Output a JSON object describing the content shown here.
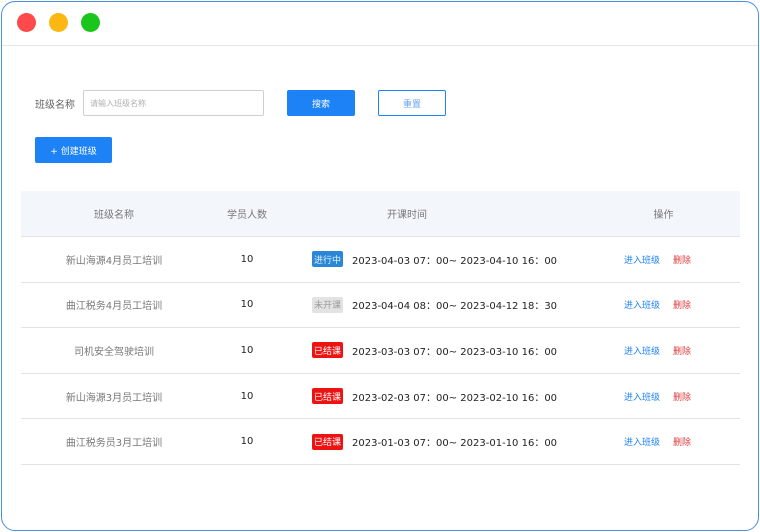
{
  "window": {
    "controls": [
      "close",
      "minimize",
      "maximize"
    ],
    "colors": {
      "close": "#fe4a4a",
      "minimize": "#fcb713",
      "maximize": "#1cc51c",
      "border": "#4a90e2"
    }
  },
  "filter": {
    "label": "班级名称",
    "placeholder": "请输入班级名称",
    "search_label": "搜索",
    "reset_label": "重置"
  },
  "create_button_label": "+ 创建班级",
  "table": {
    "headers": {
      "name": "班级名称",
      "count": "学员人数",
      "time": "开课时间",
      "ops": "操作"
    },
    "rows": [
      {
        "name": "新山海源4月员工培训",
        "count": "10",
        "status": "进行中",
        "status_type": "ongoing",
        "time": "2023-04-03 07：00~ 2023-04-10 16：00",
        "enter": "进入班级",
        "delete": "删除"
      },
      {
        "name": "曲江税务4月员工培训",
        "count": "10",
        "status": "未开课",
        "status_type": "notstarted",
        "time": "2023-04-04 08：00~ 2023-04-12 18：30",
        "enter": "进入班级",
        "delete": "删除"
      },
      {
        "name": "司机安全驾驶培训",
        "count": "10",
        "status": "已结课",
        "status_type": "ended",
        "time": "2023-03-03 07：00~ 2023-03-10 16：00",
        "enter": "进入班级",
        "delete": "删除"
      },
      {
        "name": "新山海源3月员工培训",
        "count": "10",
        "status": "已结课",
        "status_type": "ended",
        "time": "2023-02-03 07：00~ 2023-02-10 16：00",
        "enter": "进入班级",
        "delete": "删除"
      },
      {
        "name": "曲江税务员3月工培训",
        "count": "10",
        "status": "已结课",
        "status_type": "ended",
        "time": "2023-01-03 07：00~ 2023-01-10 16：00",
        "enter": "进入班级",
        "delete": "删除"
      }
    ]
  },
  "colors": {
    "primary": "#1d82f5",
    "ongoing": "#2a86d6",
    "notstarted": "#e3e3e3",
    "ended": "#ee1313",
    "delete": "#e23b3b"
  }
}
